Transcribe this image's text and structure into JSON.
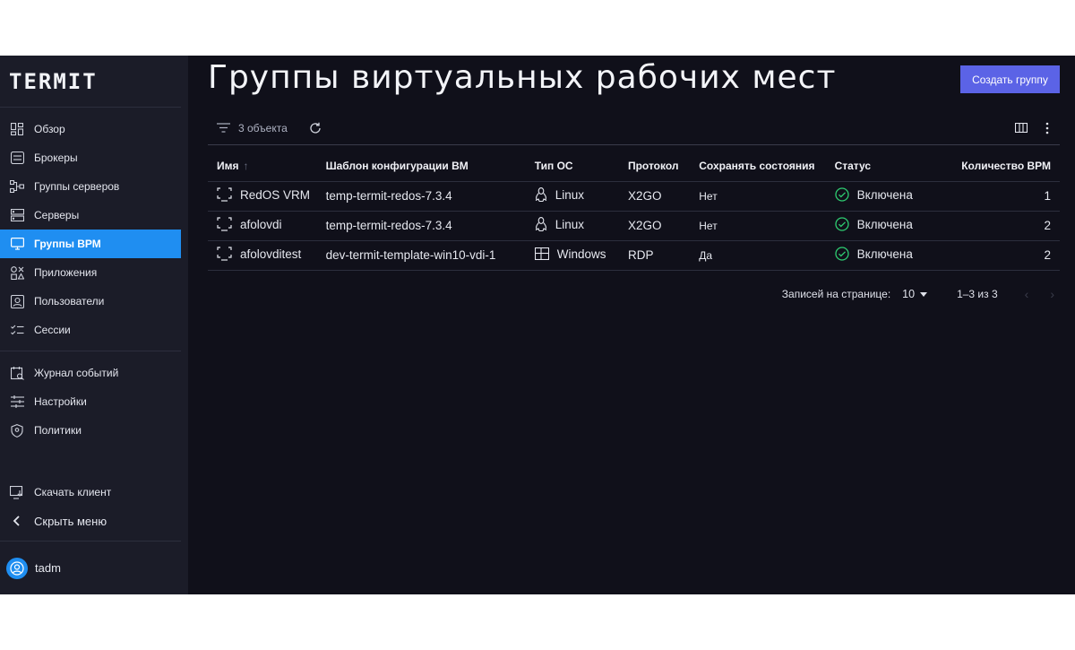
{
  "app": {
    "logo": "TERMIT"
  },
  "sidebar": {
    "items": [
      {
        "label": "Обзор",
        "icon": "dashboard-icon"
      },
      {
        "label": "Брокеры",
        "icon": "broker-icon"
      },
      {
        "label": "Группы серверов",
        "icon": "server-groups-icon"
      },
      {
        "label": "Серверы",
        "icon": "server-icon"
      },
      {
        "label": "Группы ВРМ",
        "icon": "monitor-icon",
        "active": true
      },
      {
        "label": "Приложения",
        "icon": "apps-icon"
      },
      {
        "label": "Пользователи",
        "icon": "user-card-icon"
      },
      {
        "label": "Сессии",
        "icon": "sessions-icon"
      }
    ],
    "items2": [
      {
        "label": "Журнал событий",
        "icon": "event-log-icon"
      },
      {
        "label": "Настройки",
        "icon": "sliders-icon"
      },
      {
        "label": "Политики",
        "icon": "shield-icon"
      }
    ],
    "download_client": "Скачать клиент",
    "hide_menu": "Скрыть меню",
    "user": "tadm"
  },
  "main": {
    "title": "Группы виртуальных рабочих мест",
    "create_button": "Создать группу",
    "toolbar": {
      "count_label": "3 объекта"
    },
    "table": {
      "headers": {
        "name": "Имя",
        "template": "Шаблон конфигурации ВМ",
        "os": "Тип ОС",
        "protocol": "Протокол",
        "persist": "Сохранять состояния",
        "status": "Статус",
        "count": "Количество ВРМ"
      },
      "rows": [
        {
          "name": "RedOS VRM",
          "template": "temp-termit-redos-7.3.4",
          "os": "Linux",
          "protocol": "X2GO",
          "persist": "Нет",
          "status": "Включена",
          "count": "1"
        },
        {
          "name": "afolovdi",
          "template": "temp-termit-redos-7.3.4",
          "os": "Linux",
          "protocol": "X2GO",
          "persist": "Нет",
          "status": "Включена",
          "count": "2"
        },
        {
          "name": "afolovditest",
          "template": "dev-termit-template-win10-vdi-1",
          "os": "Windows",
          "protocol": "RDP",
          "persist": "Да",
          "status": "Включена",
          "count": "2"
        }
      ]
    },
    "pagination": {
      "label": "Записей на странице:",
      "per_page": "10",
      "range": "1–3 из 3"
    }
  },
  "colors": {
    "accent": "#1f8ef1",
    "button": "#5b63e6",
    "success": "#2ecc71",
    "background": "#10101a",
    "sidebar": "#1b1c28"
  }
}
